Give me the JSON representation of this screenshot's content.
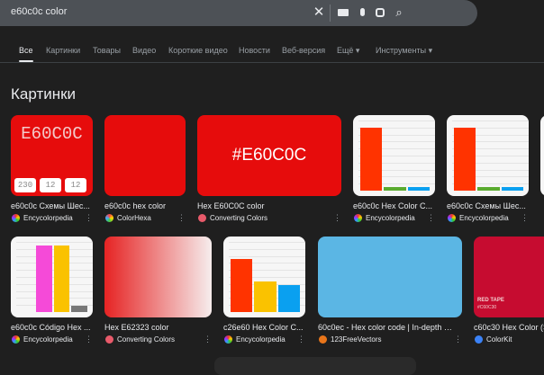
{
  "search": {
    "query": "e60c0c color",
    "icons": [
      "close-icon",
      "keyboard-icon",
      "mic-icon",
      "lens-icon",
      "search-icon"
    ]
  },
  "tabs": [
    {
      "label": "Все",
      "active": true
    },
    {
      "label": "Картинки"
    },
    {
      "label": "Товары"
    },
    {
      "label": "Видео"
    },
    {
      "label": "Короткие видео"
    },
    {
      "label": "Новости"
    },
    {
      "label": "Веб-версия"
    },
    {
      "label": "Ещё ▾"
    },
    {
      "label": "Инструменты ▾"
    }
  ],
  "section_title": "Картинки",
  "row1": [
    {
      "title": "e60c0c Схемы Шес...",
      "source": "Encycolorpedia",
      "thumb_text": "E60C0C",
      "rgb": [
        "230",
        "12",
        "12"
      ],
      "color": "#e60c0c"
    },
    {
      "title": "e60c0c hex color",
      "source": "ColorHexa",
      "color": "#e60c0c"
    },
    {
      "title": "Hex E60C0C color",
      "source": "Converting Colors",
      "thumb_text": "#E60C0C",
      "color": "#e60c0c"
    },
    {
      "title": "e60c0c Hex Color C...",
      "source": "Encycolorpedia",
      "bars": [
        {
          "value": 90,
          "color": "#ff3300"
        },
        {
          "value": 5,
          "color": "#5aab2f"
        },
        {
          "value": 5,
          "color": "#0aa0f0"
        }
      ]
    },
    {
      "title": "e60c0c Схемы Шес...",
      "source": "Encycolorpedia",
      "bars": [
        {
          "value": 90,
          "color": "#ff3300"
        },
        {
          "value": 5,
          "color": "#5aab2f"
        },
        {
          "value": 5,
          "color": "#0aa0f0"
        }
      ]
    }
  ],
  "row2": [
    {
      "title": "e60c0c Código Hex ...",
      "source": "Encycolorpedia",
      "bars": [
        {
          "value": 0,
          "color": "#ffffff"
        },
        {
          "value": 95,
          "color": "#f54ad8"
        },
        {
          "value": 95,
          "color": "#fac200"
        },
        {
          "value": 9,
          "color": "#777777"
        }
      ]
    },
    {
      "title": "Hex E62323 color",
      "source": "Converting Colors"
    },
    {
      "title": "c26e60 Hex Color C...",
      "source": "Encycolorpedia",
      "bars": [
        {
          "value": 76,
          "color": "#ff3300"
        },
        {
          "value": 43,
          "color": "#fac200"
        },
        {
          "value": 38,
          "color": "#0aa0f0"
        }
      ]
    },
    {
      "title": "60c0ec - Hex color code | In-depth Col...",
      "source": "123FreeVectors",
      "color": "#5bb6e4"
    },
    {
      "title": "c60c30 Hex Color (S",
      "source": "ColorKit",
      "thumb_text": "RED TAPE",
      "thumb_sub": "#C60C30",
      "color": "#c60c30"
    }
  ]
}
